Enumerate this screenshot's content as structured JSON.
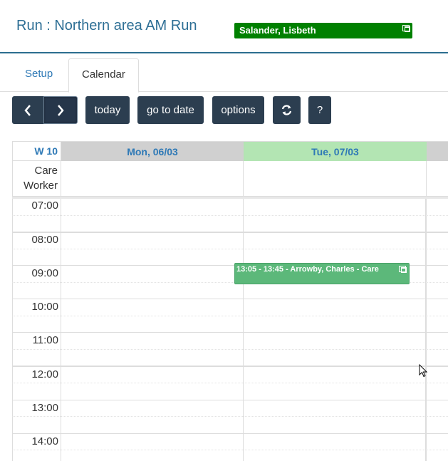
{
  "page": {
    "title": "Run : Northern area AM Run"
  },
  "tabs": [
    {
      "label": "Setup"
    },
    {
      "label": "Calendar"
    }
  ],
  "toolbar": {
    "prev_icon": "chevron-left-icon",
    "next_icon": "chevron-right-icon",
    "today_label": "today",
    "goto_label": "go to date",
    "options_label": "options",
    "refresh_icon": "refresh-icon",
    "help_label": "?"
  },
  "calendar": {
    "week_label": "W 10",
    "days": [
      {
        "label": "Mon, 06/03"
      },
      {
        "label": "Tue, 07/03"
      }
    ],
    "allday_label_line1": "Care",
    "allday_label_line2": "Worker",
    "times": [
      "07:00",
      "08:00",
      "09:00",
      "10:00",
      "11:00",
      "12:00",
      "13:00",
      "14:00"
    ],
    "events": [
      {
        "title": "Salander, Lisbeth",
        "color": "#008000"
      },
      {
        "title": "13:05 - 13:45 - Arrowby, Charles - Care",
        "color": "#5cb87a"
      }
    ]
  },
  "colors": {
    "button_bg": "#2c3e50",
    "link": "#2e79b6",
    "today_header": "#b3e5b3"
  }
}
